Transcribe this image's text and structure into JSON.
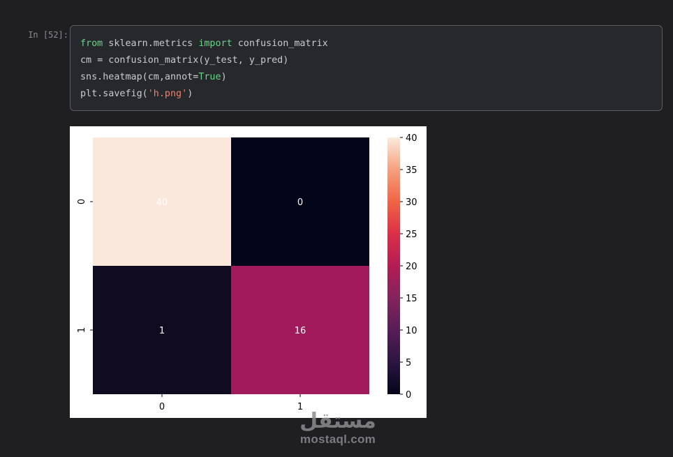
{
  "cell": {
    "prompt": "In [52]:",
    "code": [
      [
        {
          "t": "from",
          "c": "kw"
        },
        {
          "t": " sklearn.metrics ",
          "c": ""
        },
        {
          "t": "import",
          "c": "kw"
        },
        {
          "t": " confusion_matrix",
          "c": ""
        }
      ],
      [
        {
          "t": "cm ",
          "c": ""
        },
        {
          "t": "=",
          "c": "op"
        },
        {
          "t": " confusion_matrix(y_test, y_pred)",
          "c": ""
        }
      ],
      [
        {
          "t": "sns.heatmap(cm,annot",
          "c": ""
        },
        {
          "t": "=",
          "c": "op"
        },
        {
          "t": "True",
          "c": "kw"
        },
        {
          "t": ")",
          "c": ""
        }
      ],
      [
        {
          "t": "plt.savefig(",
          "c": ""
        },
        {
          "t": "'h.png'",
          "c": "str"
        },
        {
          "t": ")",
          "c": ""
        }
      ]
    ]
  },
  "chart_data": {
    "type": "heatmap",
    "title": "",
    "xlabel": "",
    "ylabel": "",
    "x_ticks": [
      "0",
      "1"
    ],
    "y_ticks": [
      "0",
      "1"
    ],
    "values": [
      [
        40,
        0
      ],
      [
        1,
        16
      ]
    ],
    "annot": true,
    "colormap": "rocket",
    "colorbar": {
      "min": 0,
      "max": 40,
      "ticks": [
        0,
        5,
        10,
        15,
        20,
        25,
        30,
        35,
        40
      ]
    },
    "cell_colors": [
      [
        "#fae8dc",
        "#03051a"
      ],
      [
        "#110b22",
        "#a11a5b"
      ]
    ],
    "annot_color": "#ffffff"
  },
  "watermark": {
    "logo": "مستقل",
    "text": "mostaql.com"
  }
}
